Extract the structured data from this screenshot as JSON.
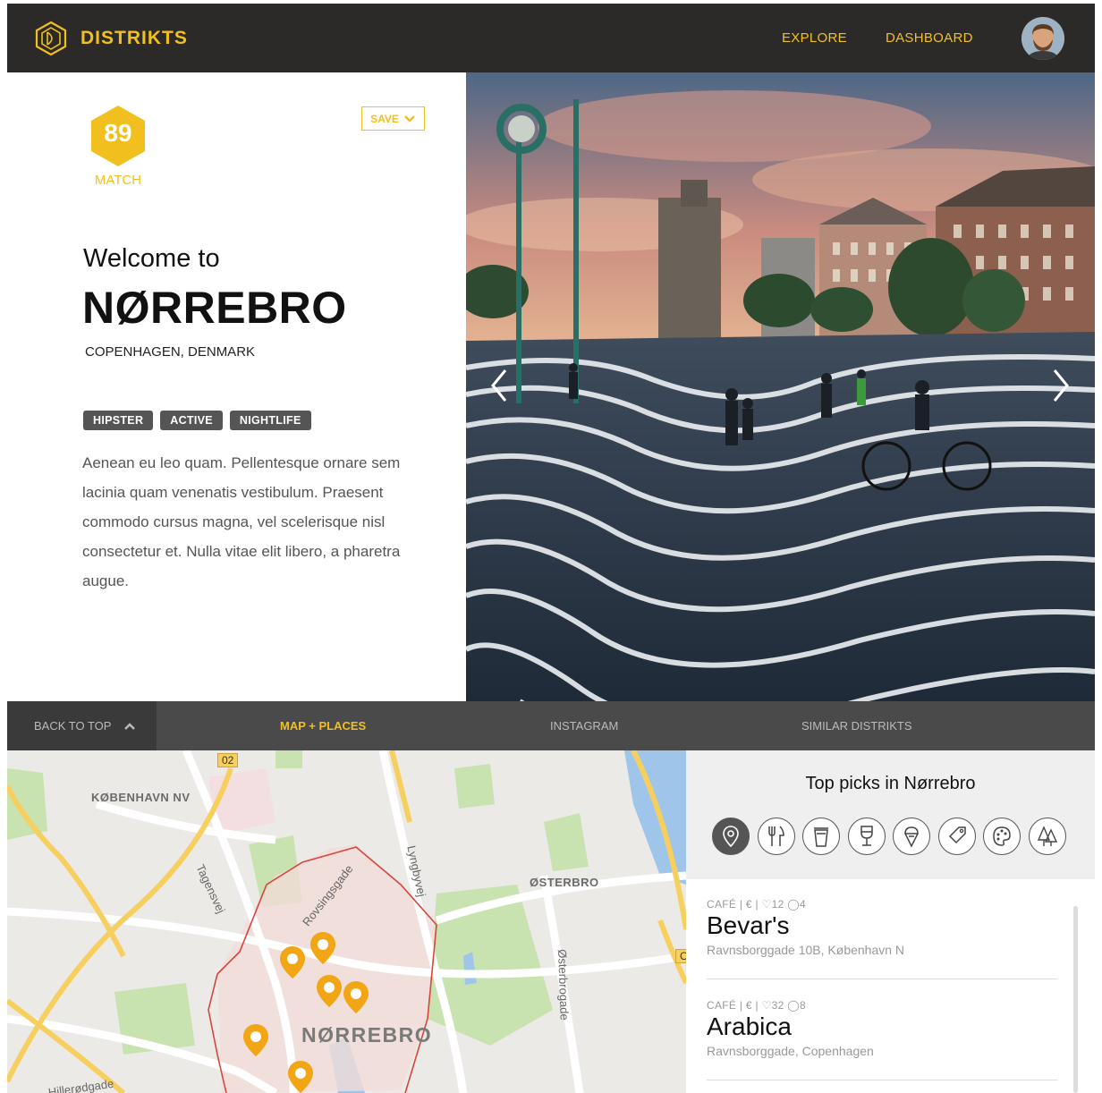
{
  "header": {
    "logo_text": "DISTRIKTS",
    "nav": [
      "EXPLORE",
      "DASHBOARD"
    ]
  },
  "hero": {
    "match_score": "89",
    "match_label": "MATCH",
    "save_label": "SAVE",
    "welcome": "Welcome to",
    "district": "NØRREBRO",
    "city": "COPENHAGEN, DENMARK",
    "tags": [
      "HIPSTER",
      "ACTIVE",
      "NIGHTLIFE"
    ],
    "description": "Aenean eu leo quam. Pellentesque ornare sem lacinia quam venenatis vestibulum. Praesent commodo cursus magna, vel scelerisque nisl consectetur et. Nulla vitae elit libero, a pharetra augue."
  },
  "subnav": {
    "back_to_top": "BACK TO TOP",
    "tabs": [
      "MAP + PLACES",
      "INSTAGRAM",
      "SIMILAR DISTRIKTS"
    ],
    "active_tab": "MAP + PLACES"
  },
  "map": {
    "areas": [
      "KØBENHAVN NV",
      "ØSTERBRO",
      "NØRREBRO"
    ],
    "road_badge": "02",
    "edge_badge": "O",
    "streets": [
      "Tagensvej",
      "Rovsingsgade",
      "Lyngbyvej",
      "Østerbrogade",
      "Hillerødgade"
    ]
  },
  "picks": {
    "title": "Top picks in Nørrebro",
    "categories": [
      "location-pin-icon",
      "fork-knife-icon",
      "coffee-cup-icon",
      "wine-glass-icon",
      "ice-cream-icon",
      "tag-icon",
      "palette-icon",
      "trees-icon"
    ],
    "places": [
      {
        "category": "CAFÉ",
        "price": "€",
        "likes": "12",
        "comments": "4",
        "name": "Bevar's",
        "address": "Ravnsborggade 10B, København N"
      },
      {
        "category": "CAFÉ",
        "price": "€",
        "likes": "32",
        "comments": "8",
        "name": "Arabica",
        "address": "Ravnsborggade, Copenhagen"
      }
    ]
  },
  "colors": {
    "accent": "#f2c01e",
    "header_bg": "#2b2a28",
    "district_border": "#d9453d",
    "pin": "#f2a515"
  }
}
